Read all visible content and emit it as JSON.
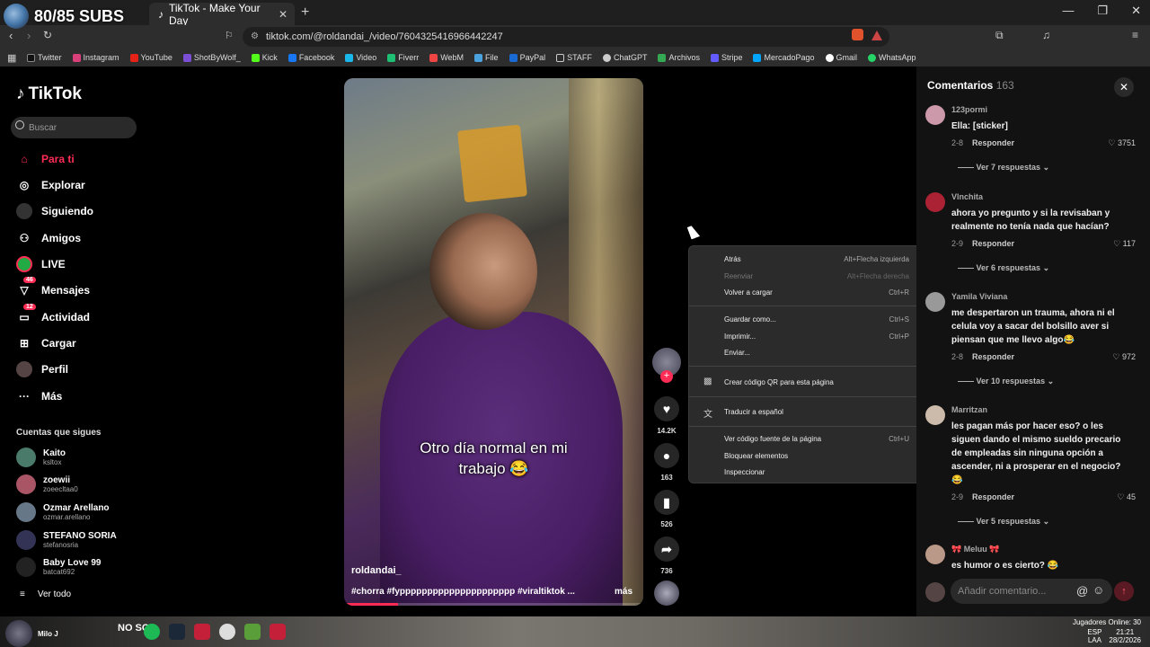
{
  "overlay": {
    "subs": "80/85 SUBS"
  },
  "browser": {
    "tab_title": "TikTok - Make Your Day",
    "url": "tiktok.com/@roldandai_/video/7604325416966442247",
    "bookmarks": [
      "Twitter",
      "Instagram",
      "YouTube",
      "ShotByWolf_",
      "Kick",
      "Facebook",
      "Video",
      "Fiverr",
      "WebM",
      "File",
      "PayPal",
      "STAFF",
      "ChatGPT",
      "Archivos",
      "Stripe",
      "MercadoPago",
      "Gmail",
      "WhatsApp"
    ]
  },
  "sidebar": {
    "logo": "TikTok",
    "search_placeholder": "Buscar",
    "nav": [
      {
        "label": "Para ti",
        "icon": "home-icon"
      },
      {
        "label": "Explorar",
        "icon": "compass-icon"
      },
      {
        "label": "Siguiendo",
        "icon": "following-icon"
      },
      {
        "label": "Amigos",
        "icon": "friends-icon"
      },
      {
        "label": "LIVE",
        "icon": "live-icon"
      },
      {
        "label": "Mensajes",
        "icon": "messages-icon",
        "badge": "46"
      },
      {
        "label": "Actividad",
        "icon": "activity-icon",
        "badge": "12"
      },
      {
        "label": "Cargar",
        "icon": "upload-icon"
      },
      {
        "label": "Perfil",
        "icon": "profile-icon"
      },
      {
        "label": "Más",
        "icon": "more-icon"
      }
    ],
    "following_title": "Cuentas que sigues",
    "following": [
      {
        "name": "Kaito",
        "handle": "ksltox"
      },
      {
        "name": "zoewii",
        "handle": "zoeecltaa0"
      },
      {
        "name": "Ozmar Arellano",
        "handle": "ozmar.arellano"
      },
      {
        "name": "STEFANO SORIA",
        "handle": "stefanosria"
      },
      {
        "name": "Baby Love 99",
        "handle": "batcat692"
      }
    ],
    "see_all": "Ver todo"
  },
  "video": {
    "caption_line1": "Otro día normal en mi",
    "caption_line2": "trabajo 😂",
    "author": "roldandai_",
    "tags": "#chorra #fyppppppppppppppppppppp #viraltiktok ...",
    "more": "más",
    "progress": 0.18
  },
  "actions": {
    "likes": "14.2K",
    "comments": "163",
    "saves": "526",
    "shares": "736"
  },
  "context_menu": {
    "items": [
      {
        "label": "Atrás",
        "shortcut": "Alt+Flecha izquierda"
      },
      {
        "label": "Reenviar",
        "shortcut": "Alt+Flecha derecha",
        "disabled": true
      },
      {
        "label": "Volver a cargar",
        "shortcut": "Ctrl+R"
      },
      {
        "label": "Guardar como...",
        "shortcut": "Ctrl+S"
      },
      {
        "label": "Imprimir...",
        "shortcut": "Ctrl+P"
      },
      {
        "label": "Enviar...",
        "shortcut": ""
      },
      {
        "label": "Crear código QR para esta página",
        "shortcut": ""
      },
      {
        "label": "Traducir a español",
        "shortcut": ""
      },
      {
        "label": "Ver código fuente de la página",
        "shortcut": "Ctrl+U"
      },
      {
        "label": "Bloquear elementos",
        "shortcut": ""
      },
      {
        "label": "Inspeccionar",
        "shortcut": ""
      }
    ]
  },
  "comments": {
    "title": "Comentarios",
    "count": "163",
    "list": [
      {
        "user": "123pormi",
        "text": "Ella: [sticker]",
        "date": "2-8",
        "reply": "Responder",
        "likes": "3751",
        "more": "Ver 7 respuestas"
      },
      {
        "user": "Vlnchita",
        "text": "ahora yo pregunto y si la revisaban y realmente no tenía nada que hacían?",
        "date": "2-9",
        "reply": "Responder",
        "likes": "117",
        "more": "Ver 6 respuestas"
      },
      {
        "user": "Yamila Viviana",
        "text": "me despertaron un trauma, ahora ni el celula voy a sacar del bolsillo aver si piensan que me llevo algo😂",
        "date": "2-8",
        "reply": "Responder",
        "likes": "972",
        "more": "Ver 10 respuestas"
      },
      {
        "user": "Marritzan",
        "text": "les pagan más por hacer eso? o les siguen dando el mismo sueldo precario de empleadas sin ninguna opción a ascender, ni a prosperar en el negocio?😂",
        "date": "2-9",
        "reply": "Responder",
        "likes": "45",
        "more": "Ver 5 respuestas"
      },
      {
        "user": "🎀 Meluu 🎀",
        "text": "es humor o es cierto? 😂",
        "date": "",
        "reply": "",
        "likes": "",
        "more": ""
      }
    ],
    "add_placeholder": "Añadir comentario..."
  },
  "taskbar": {
    "user": "Milo J",
    "nosc": "NO SC",
    "status": "Jugadores Online: 30",
    "lang": "ESP",
    "lang2": "LAA",
    "time": "21:21",
    "date": "28/2/2026"
  }
}
